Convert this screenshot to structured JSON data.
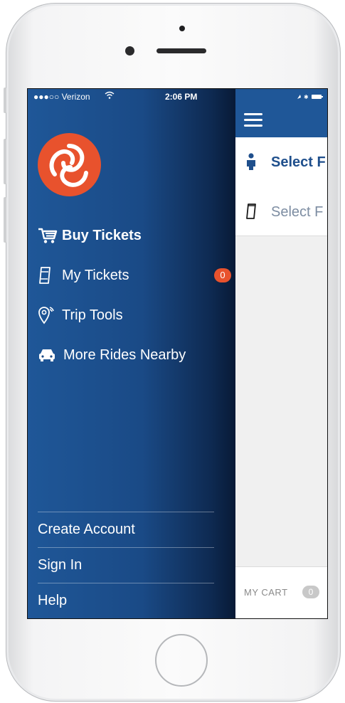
{
  "status_bar": {
    "carrier": "●●●○○ Verizon",
    "time": "2:06 PM"
  },
  "drawer": {
    "menu": [
      {
        "label": "Buy Tickets",
        "icon": "cart-icon",
        "bold": true
      },
      {
        "label": "My Tickets",
        "icon": "ticket-icon",
        "badge": "0"
      },
      {
        "label": "Trip Tools",
        "icon": "location-pin-icon"
      },
      {
        "label": "More Rides Nearby",
        "icon": "car-icon"
      }
    ],
    "bottom_links": [
      {
        "label": "Create Account"
      },
      {
        "label": "Sign In"
      },
      {
        "label": "Help"
      }
    ]
  },
  "main": {
    "select_rider": "Select F",
    "select_fare": "Select F",
    "cart": {
      "label": "MY CART",
      "count": "0"
    }
  },
  "colors": {
    "drawer_blue": "#1f5798",
    "accent_orange": "#e8522d",
    "select_text": "#1f4f8c"
  }
}
